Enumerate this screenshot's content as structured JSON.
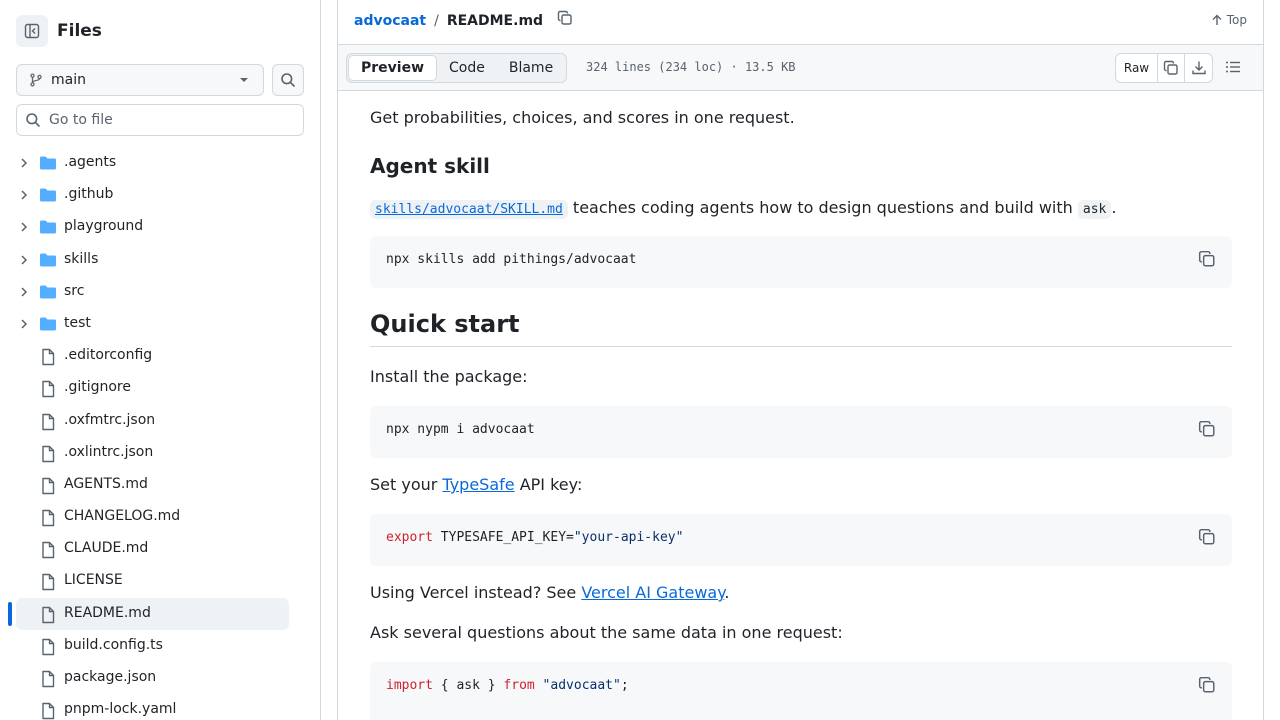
{
  "sidebar": {
    "title": "Files",
    "branch": "main",
    "goto_placeholder": "Go to file",
    "items": [
      {
        "name": ".agents",
        "type": "folder"
      },
      {
        "name": ".github",
        "type": "folder"
      },
      {
        "name": "playground",
        "type": "folder"
      },
      {
        "name": "skills",
        "type": "folder"
      },
      {
        "name": "src",
        "type": "folder"
      },
      {
        "name": "test",
        "type": "folder"
      },
      {
        "name": ".editorconfig",
        "type": "file"
      },
      {
        "name": ".gitignore",
        "type": "file"
      },
      {
        "name": ".oxfmtrc.json",
        "type": "file"
      },
      {
        "name": ".oxlintrc.json",
        "type": "file"
      },
      {
        "name": "AGENTS.md",
        "type": "file"
      },
      {
        "name": "CHANGELOG.md",
        "type": "file"
      },
      {
        "name": "CLAUDE.md",
        "type": "file"
      },
      {
        "name": "LICENSE",
        "type": "file"
      },
      {
        "name": "README.md",
        "type": "file",
        "selected": true
      },
      {
        "name": "build.config.ts",
        "type": "file"
      },
      {
        "name": "package.json",
        "type": "file"
      },
      {
        "name": "pnpm-lock.yaml",
        "type": "file"
      }
    ]
  },
  "header": {
    "repo": "advocaat",
    "separator": "/",
    "file": "README.md",
    "top_label": "Top"
  },
  "toolbar": {
    "tabs": [
      "Preview",
      "Code",
      "Blame"
    ],
    "file_info": "324 lines (234 loc) · 13.5 KB",
    "raw_label": "Raw"
  },
  "content": {
    "intro": "Get probabilities, choices, and scores in one request.",
    "agent_skill_heading": "Agent skill",
    "skill_link": "skills/advocaat/SKILL.md",
    "skill_text": " teaches coding agents how to design questions and build with ",
    "skill_code": "ask",
    "skill_end": ".",
    "code1": "npx skills add pithings/advocaat",
    "quick_start_heading": "Quick start",
    "install_text": "Install the package:",
    "code2": "npx nypm i advocaat",
    "apikey_pre": "Set your ",
    "apikey_link": "TypeSafe",
    "apikey_post": " API key:",
    "code3_kw": "export",
    "code3_var": " TYPESAFE_API_KEY=",
    "code3_str": "\"your-api-key\"",
    "vercel_pre": "Using Vercel instead? See ",
    "vercel_link": "Vercel AI Gateway",
    "vercel_post": ".",
    "ask_text": "Ask several questions about the same data in one request:",
    "code4_kw1": "import",
    "code4_mid": " { ask } ",
    "code4_kw2": "from",
    "code4_str": " \"advocaat\"",
    "code4_end": ";"
  },
  "colors": {
    "accent": "#0969da",
    "folder": "#54aeff",
    "keyword": "#cf222e",
    "string": "#0a3069"
  }
}
